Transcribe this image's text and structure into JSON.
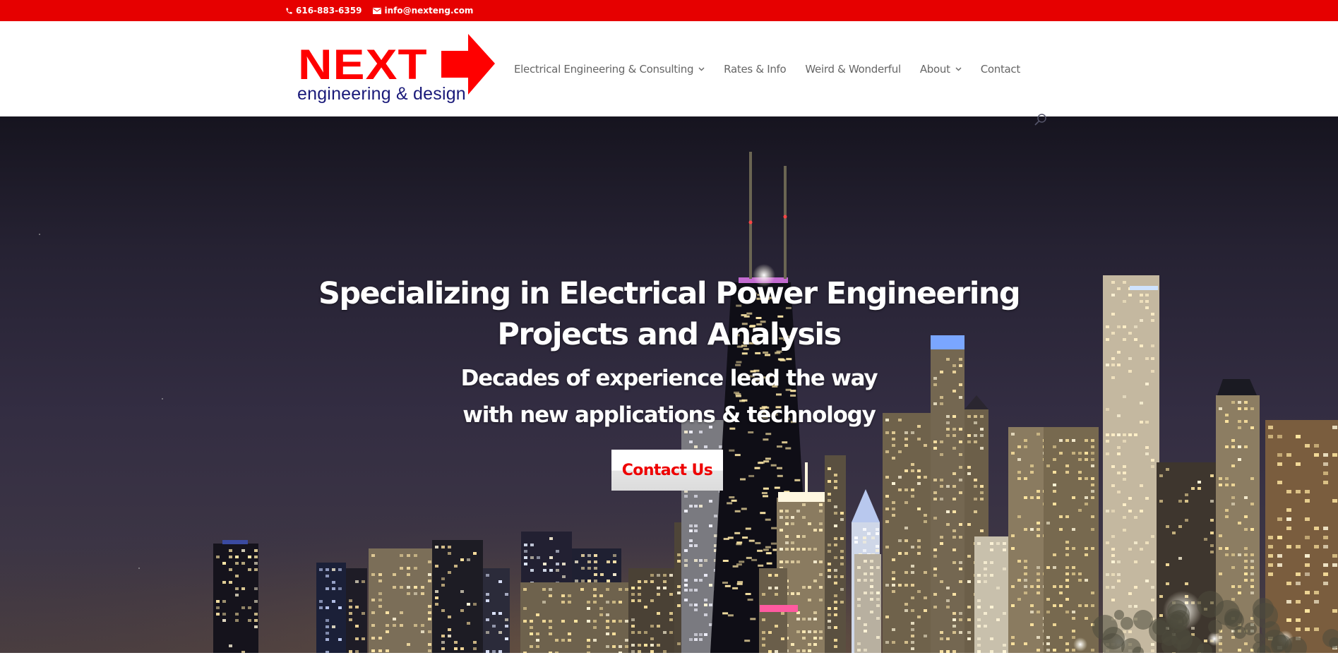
{
  "topbar": {
    "phone": "616-883-6359",
    "phone_icon": "phone-icon",
    "email": "info@nexteng.com",
    "email_icon": "envelope-icon",
    "background_color": "#e60000"
  },
  "logo": {
    "brand": "NEXT",
    "tagline": "engineering & design",
    "arrow_icon": "right-arrow-icon",
    "brand_color": "#ff0000",
    "tagline_color": "#1a1a7a"
  },
  "nav": {
    "items": [
      {
        "label": "Electrical Engineering & Consulting",
        "has_dropdown": true
      },
      {
        "label": "Rates & Info",
        "has_dropdown": false
      },
      {
        "label": "Weird & Wonderful",
        "has_dropdown": false
      },
      {
        "label": "About",
        "has_dropdown": true
      },
      {
        "label": "Contact",
        "has_dropdown": false
      }
    ],
    "search_icon": "search-icon"
  },
  "hero": {
    "title_line1": "Specializing in Electrical Power Engineering",
    "title_line2": "Projects and Analysis",
    "subtitle_line1": "Decades of experience lead the way",
    "subtitle_line2": "with new applications & technology",
    "cta_label": "Contact Us",
    "cta_text_color": "#ee0000",
    "background_image": "night-city-skyline"
  }
}
